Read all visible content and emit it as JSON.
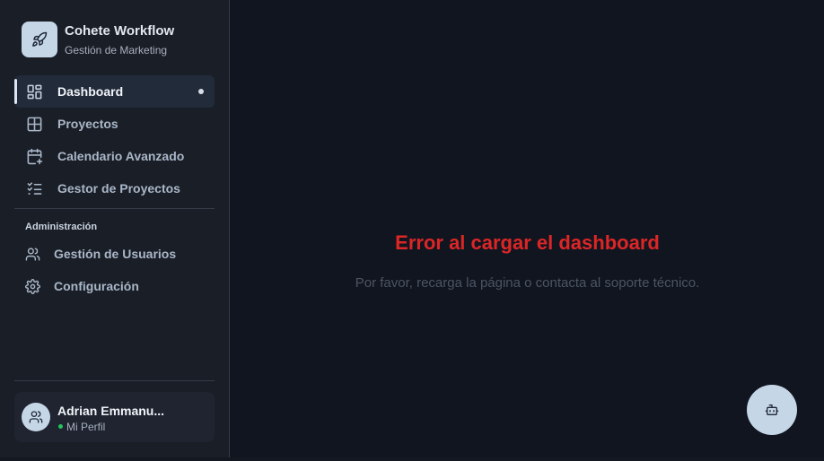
{
  "brand": {
    "title": "Cohete Workflow",
    "subtitle": "Gestión de Marketing",
    "icon": "rocket-icon"
  },
  "nav": {
    "items": [
      {
        "label": "Dashboard",
        "icon": "dashboard-icon",
        "active": true
      },
      {
        "label": "Proyectos",
        "icon": "grid-icon"
      },
      {
        "label": "Calendario Avanzado",
        "icon": "calendar-plus-icon"
      },
      {
        "label": "Gestor de Proyectos",
        "icon": "checklist-icon"
      }
    ]
  },
  "admin": {
    "title": "Administración",
    "items": [
      {
        "label": "Gestión de Usuarios",
        "icon": "users-icon"
      },
      {
        "label": "Configuración",
        "icon": "gear-icon"
      }
    ]
  },
  "profile": {
    "name": "Adrian Emmanu...",
    "subtitle": "Mi Perfil",
    "status_color": "#22c55e"
  },
  "main": {
    "error_title": "Error al cargar el dashboard",
    "error_message": "Por favor, recarga la página o contacta al soporte técnico."
  },
  "fab": {
    "icon": "bot-icon"
  },
  "colors": {
    "error": "#dc2626",
    "accent": "#c5d6e7",
    "background": "#111520",
    "sidebar": "#1a1e27"
  }
}
